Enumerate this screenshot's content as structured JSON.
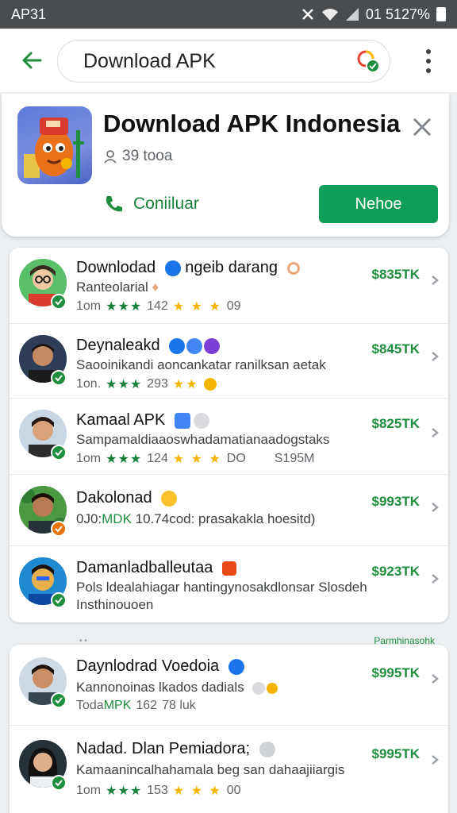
{
  "status_bar": {
    "left": "AP31",
    "right": "01 5127%"
  },
  "search": {
    "value": "Download APK"
  },
  "hero": {
    "title": "Download APK Indonesia",
    "subtitle": "39 tooa",
    "call_label": "Coniiluar",
    "action_label": "Nehoe"
  },
  "list1": [
    {
      "title": "Downlodad",
      "title_extra": "ngeib darang",
      "subtitle": "Ranteolarial",
      "meta_left": "1om",
      "meta_stars_green": "★★★",
      "meta_num": "142",
      "meta_stars_gold": "★ ★ ★",
      "meta_right": "09",
      "price": "$835TK"
    },
    {
      "title": "Deynaleakd",
      "subtitle": "Saooinikandi aoncankatar ranilksan aetak",
      "meta_left": "1on.",
      "meta_stars_green": "★★★",
      "meta_num": "293",
      "meta_stars_gold": "★★",
      "meta_right": "",
      "price": "$845TK"
    },
    {
      "title": "Kamaal APK",
      "subtitle": "Sampamaldiaaoswhadamatianaadogstaks",
      "meta_left": "1om",
      "meta_stars_green": "★★★",
      "meta_num": "124",
      "meta_stars_gold": "★ ★ ★",
      "meta_right": "DO",
      "meta_far": "S195M",
      "price": "$825TK"
    },
    {
      "title": "Dakolonad",
      "subtitle_prefix": "0J0:",
      "subtitle_green": "MDK",
      "subtitle": "10.74cod: prasakakla hoesitd)",
      "price": "$993TK"
    },
    {
      "title": "Damanladballeutaa",
      "subtitle": "Pols ldealahiagar hantingynosakdlonsar Slosdeh",
      "subtitle2": "Insthinouoen",
      "price": "$923TK"
    }
  ],
  "section_link": "Parmhinasohk",
  "list2": [
    {
      "title": "Daynlodrad Voedoia",
      "subtitle": "Kannonoinas lkados dadials",
      "meta_prefix": "Toda",
      "meta_green": "MPK",
      "meta_num": "162",
      "meta_right": "78 luk",
      "price": "$995TK"
    },
    {
      "title": "Nadad. Dlan Pemiadora;",
      "subtitle": "Kamaanincalhahamala beg san dahaajiiargis",
      "meta_left": "1om",
      "meta_stars_green": "★★★",
      "meta_num": "153",
      "meta_stars_gold": "★ ★ ★",
      "meta_right": "00",
      "price": "$995TK"
    }
  ],
  "colors": {
    "accent_green": "#0f9d58",
    "price_green": "#1e8e3e",
    "star_gold": "#f4b400",
    "status_bar": "#4a4d50"
  }
}
